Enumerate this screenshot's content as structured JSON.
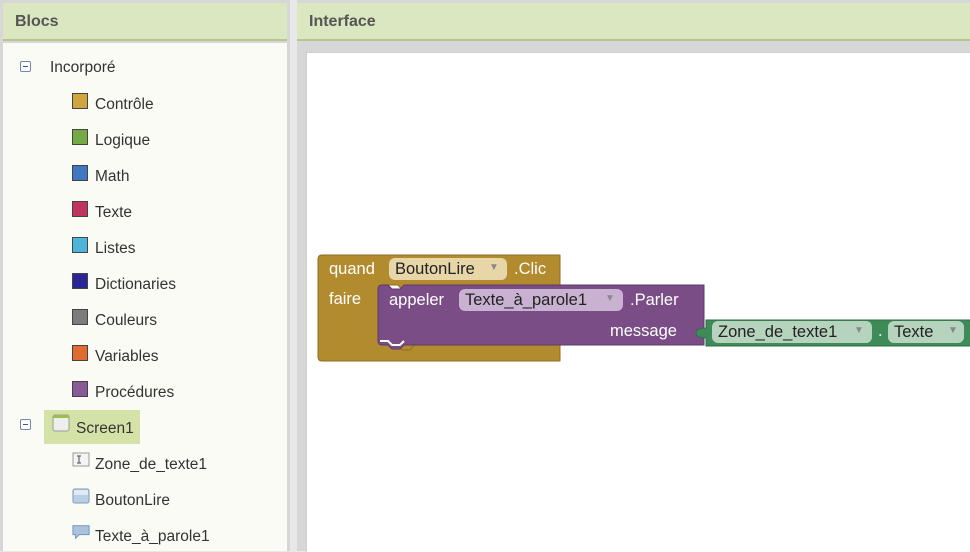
{
  "blocks_panel": {
    "title": "Blocs",
    "builtin": {
      "label": "Incorporé",
      "items": [
        {
          "label": "Contrôle",
          "color": "#d0a43f"
        },
        {
          "label": "Logique",
          "color": "#76a844"
        },
        {
          "label": "Math",
          "color": "#3f78c0"
        },
        {
          "label": "Texte",
          "color": "#c0355f"
        },
        {
          "label": "Listes",
          "color": "#4db5da"
        },
        {
          "label": "Dictionaries",
          "color": "#2a2597"
        },
        {
          "label": "Couleurs",
          "color": "#7c7c7c"
        },
        {
          "label": "Variables",
          "color": "#e06c30"
        },
        {
          "label": "Procédures",
          "color": "#8a5a98"
        }
      ]
    },
    "screen": {
      "label": "Screen1",
      "components": [
        {
          "label": "Zone_de_texte1",
          "icon": "textbox-icon"
        },
        {
          "label": "BoutonLire",
          "icon": "button-icon"
        },
        {
          "label": "Texte_à_parole1",
          "icon": "speech-icon"
        }
      ]
    }
  },
  "viewer": {
    "title": "Interface",
    "event_block": {
      "when_label": "quand",
      "component": "BoutonLire",
      "event": ".Clic",
      "do_label": "faire",
      "color": "#b38b2f"
    },
    "call_block": {
      "call_label": "appeler",
      "component": "Texte_à_parole1",
      "method": ".Parler",
      "arg_label": "message",
      "color": "#7a4d87"
    },
    "getter_block": {
      "component": "Zone_de_texte1",
      "dot": ".",
      "property": "Texte",
      "color": "#3e8a59"
    }
  }
}
